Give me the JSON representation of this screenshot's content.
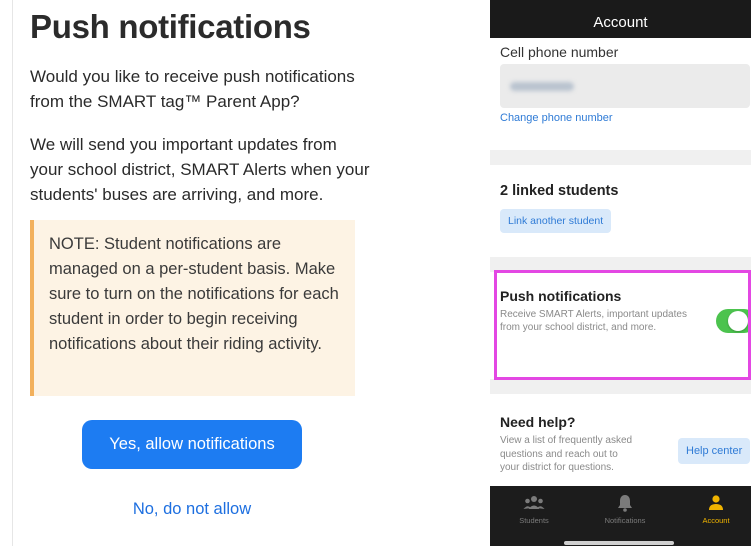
{
  "left": {
    "title": "Push notifications",
    "para1": "Would you like to receive push notifications from the SMART tag™ Parent App?",
    "para2": "We will send you important updates from your school district, SMART Alerts when your students' buses are arriving, and more.",
    "note": "NOTE: Student notifications are managed on a per-student basis. Make sure to turn on the notifications for each student in order to begin receiving notifications about their riding activity.",
    "allow_button": "Yes, allow notifications",
    "deny_link": "No, do not allow"
  },
  "phone": {
    "header_title": "Account",
    "cell": {
      "label": "Cell phone number",
      "change_link": "Change phone number"
    },
    "students": {
      "title": "2 linked students",
      "link_button": "Link another student"
    },
    "push": {
      "title": "Push notifications",
      "description": "Receive SMART Alerts, important updates from your school district, and more.",
      "toggle_on": true,
      "toggle_color": "#4cc34e",
      "highlight_color": "#e347e3"
    },
    "help": {
      "title": "Need help?",
      "description": "View a list of frequently asked questions and reach out to your district for questions.",
      "button": "Help center"
    },
    "tabs": [
      {
        "label": "Students",
        "icon": "students-icon"
      },
      {
        "label": "Notifications",
        "icon": "bell-icon"
      },
      {
        "label": "Account",
        "icon": "account-icon",
        "active": true
      }
    ],
    "active_tab_color": "#f0b400"
  }
}
